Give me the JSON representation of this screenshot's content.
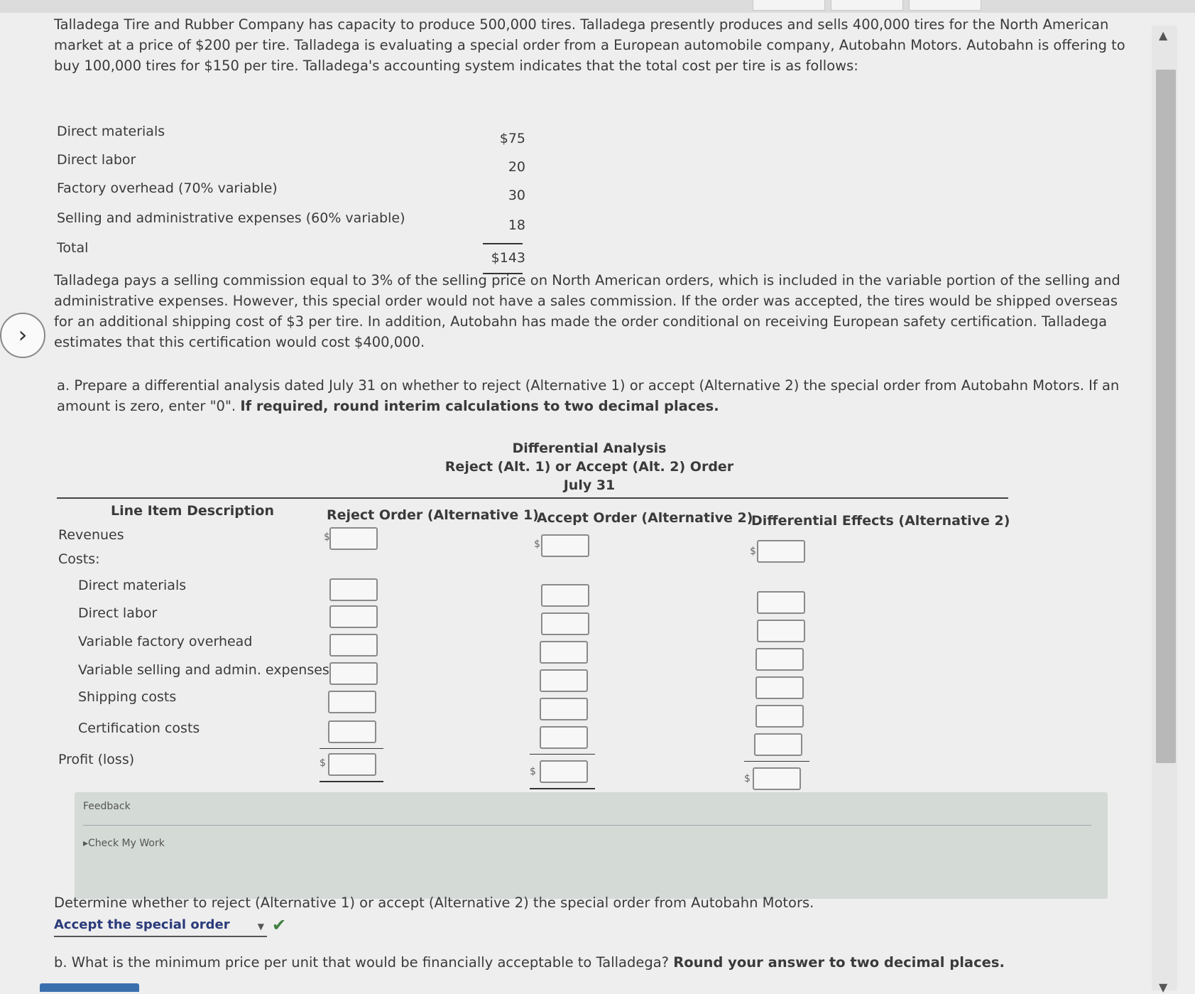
{
  "problem": {
    "intro": "Talladega Tire and Rubber Company has capacity to produce 500,000 tires. Talladega presently produces and sells 400,000 tires for the North American market at a price of $200 per tire. Talladega is evaluating a special order from a European automobile company, Autobahn Motors. Autobahn is offering to buy 100,000 tires for $150 per tire. Talladega's accounting system indicates that the total cost per tire is as follows:",
    "costs": [
      {
        "label": "Direct materials",
        "value": "$75"
      },
      {
        "label": "Direct labor",
        "value": "20"
      },
      {
        "label": "Factory overhead (70% variable)",
        "value": "30"
      },
      {
        "label": "Selling and administrative expenses (60% variable)",
        "value": "18"
      },
      {
        "label": "Total",
        "value": "$143"
      }
    ],
    "para2": "Talladega pays a selling commission equal to 3% of the selling price on North American orders, which is included in the variable portion of the selling and administrative expenses. However, this special order would not have a sales commission. If the order was accepted, the tires would be shipped overseas for an additional shipping cost of $3 per tire. In addition, Autobahn has made the order conditional on receiving European safety certification. Talladega estimates that this certification would cost $400,000.",
    "part_a_text": "a. Prepare a differential analysis dated July 31 on whether to reject (Alternative 1) or accept (Alternative 2) the special order from Autobahn Motors. If an amount is zero, enter \"0\".",
    "part_a_bold": "If required, round interim calculations to two decimal places."
  },
  "analysis": {
    "title1": "Differential Analysis",
    "title2": "Reject (Alt. 1) or Accept (Alt. 2) Order",
    "title3": "July 31",
    "col_line": "Line Item Description",
    "col_reject": "Reject Order (Alternative 1)",
    "col_accept": "Accept Order (Alternative 2)",
    "col_diff": "Differential Effects (Alternative 2)",
    "rows": {
      "revenues": "Revenues",
      "costs": "Costs:",
      "dm": "Direct materials",
      "dl": "Direct labor",
      "vfo": "Variable factory overhead",
      "vsa": "Variable selling and admin. expenses",
      "ship": "Shipping costs",
      "cert": "Certification costs",
      "profit": "Profit (loss)"
    },
    "currency_symbol": "$"
  },
  "feedback": {
    "title": "Feedback",
    "check": "Check My Work"
  },
  "determine": {
    "question": "Determine whether to reject (Alternative 1) or accept (Alternative 2) the special order from Autobahn Motors.",
    "selected": "Accept the special order",
    "status_icon": "checkmark-icon"
  },
  "part_b": {
    "text": "b. What is the minimum price per unit that would be financially acceptable to Talladega?",
    "bold": "Round your answer to two decimal places."
  }
}
